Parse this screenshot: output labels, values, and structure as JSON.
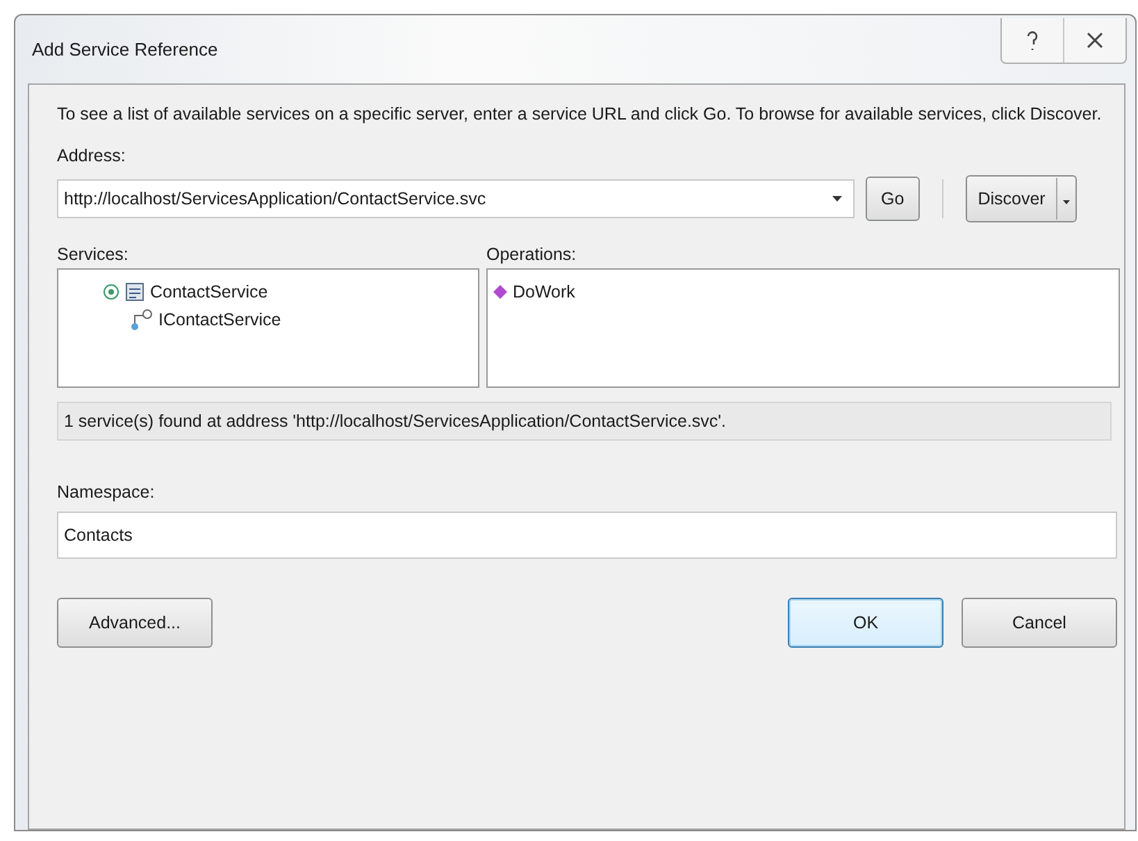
{
  "window": {
    "title": "Add Service Reference"
  },
  "description": "To see a list of available services on a specific server, enter a service URL and click Go. To browse for available services, click Discover.",
  "address": {
    "label": "Address:",
    "value": "http://localhost/ServicesApplication/ContactService.svc"
  },
  "go_button": "Go",
  "discover_button": "Discover",
  "services": {
    "label": "Services:",
    "items": [
      {
        "label": "ContactService",
        "expanded": true,
        "children": [
          {
            "label": "IContactService"
          }
        ]
      }
    ]
  },
  "operations": {
    "label": "Operations:",
    "items": [
      "DoWork"
    ]
  },
  "status": "1 service(s) found at address 'http://localhost/ServicesApplication/ContactService.svc'.",
  "namespace": {
    "label": "Namespace:",
    "value": "Contacts"
  },
  "buttons": [
    {
      "label": "Advanced...",
      "default": false
    },
    {
      "label": "OK",
      "default": true
    },
    {
      "label": "Cancel",
      "default": false
    }
  ]
}
